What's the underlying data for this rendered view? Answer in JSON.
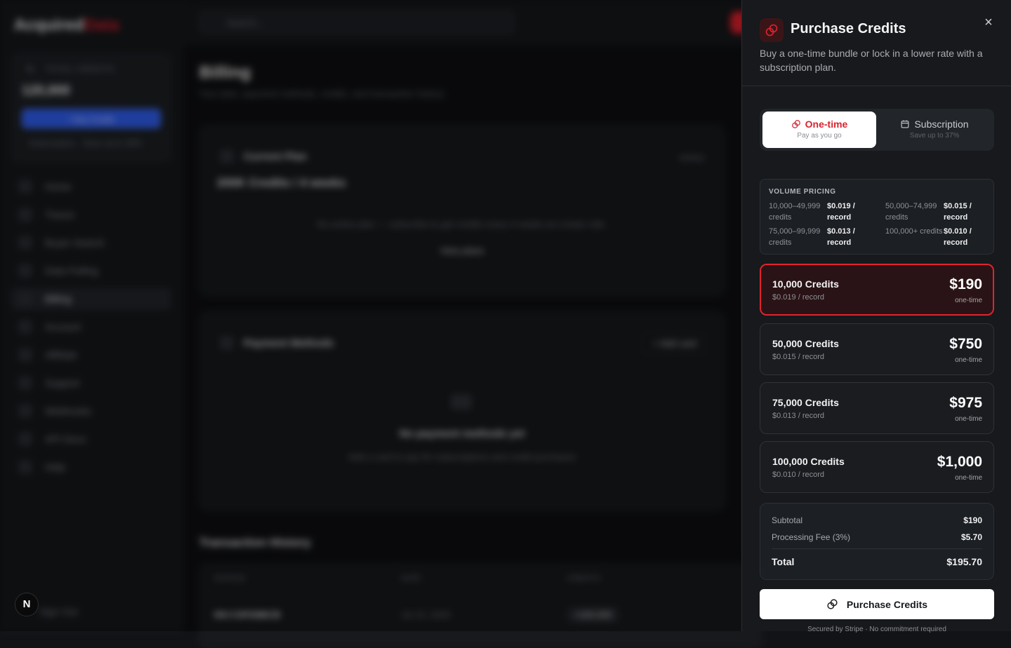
{
  "app": {
    "logo_main": "Acquired",
    "logo_accent": "Data"
  },
  "sidebar": {
    "credits_label": "TOTAL CREDITS",
    "credits_value": "120,000",
    "buy_button": "+ Buy Credits",
    "subscription_hint": "Subscription · Save up to 36%",
    "items": [
      {
        "label": "Home"
      },
      {
        "label": "Traces"
      },
      {
        "label": "Buyer Search"
      },
      {
        "label": "Data Pulling"
      },
      {
        "label": "Billing"
      },
      {
        "label": "Account"
      },
      {
        "label": "Affiliate"
      },
      {
        "label": "Support"
      },
      {
        "label": "Webhooks"
      },
      {
        "label": "API Docs"
      },
      {
        "label": "Help"
      }
    ],
    "sign_out": "Sign Out"
  },
  "topbar": {
    "search_placeholder": "Search..."
  },
  "billing": {
    "title": "Billing",
    "subtitle": "Your plan, payment methods, credits, and transaction history",
    "current_plan": {
      "title": "Current Plan",
      "badge": "Active",
      "plan_name": "200K Credits / 4 weeks",
      "empty_text": "No active plan — subscribe to get credits every 4 weeks at a lower rate.",
      "view_plans": "View plans"
    },
    "payment_methods": {
      "title": "Payment Methods",
      "add_card": "+ Add card",
      "empty_title": "No payment methods yet",
      "empty_text": "Add a card to pay for subscriptions and credit purchases"
    },
    "transactions": {
      "title": "Transaction History",
      "columns": [
        "INVOICE",
        "DATE",
        "CREDITS"
      ],
      "rows": [
        [
          "INV-C0FD8BCB",
          "Jul 15, 2025",
          "+100,000"
        ]
      ]
    }
  },
  "drawer": {
    "title": "Purchase Credits",
    "description": "Buy a one-time bundle or lock in a lower rate with a subscription plan.",
    "close_glyph": "×",
    "tabs": [
      {
        "label": "One-time",
        "sub": "Pay as you go",
        "active": true
      },
      {
        "label": "Subscription",
        "sub": "Save up to 37%",
        "active": false
      }
    ],
    "volume_pricing": {
      "title": "VOLUME PRICING",
      "tiers": [
        {
          "range": "10,000–49,999 credits",
          "price": "$0.019 / record"
        },
        {
          "range": "50,000–74,999 credits",
          "price": "$0.015 / record"
        },
        {
          "range": "75,000–99,999 credits",
          "price": "$0.013 / record"
        },
        {
          "range": "100,000+ credits",
          "price": "$0.010 / record"
        }
      ]
    },
    "packages": [
      {
        "name": "10,000 Credits",
        "rate": "$0.019 / record",
        "price": "$190",
        "type": "one-time",
        "selected": true
      },
      {
        "name": "50,000 Credits",
        "rate": "$0.015 / record",
        "price": "$750",
        "type": "one-time",
        "selected": false
      },
      {
        "name": "75,000 Credits",
        "rate": "$0.013 / record",
        "price": "$975",
        "type": "one-time",
        "selected": false
      },
      {
        "name": "100,000 Credits",
        "rate": "$0.010 / record",
        "price": "$1,000",
        "type": "one-time",
        "selected": false
      }
    ],
    "summary": {
      "subtotal_label": "Subtotal",
      "subtotal_value": "$190",
      "fee_label": "Processing Fee (3%)",
      "fee_value": "$5.70",
      "total_label": "Total",
      "total_value": "$195.70"
    },
    "purchase_button": "Purchase Credits",
    "secured_text": "Secured by Stripe · No commitment required"
  },
  "dev_badge": "N",
  "colors": {
    "accent_red": "#e0232f",
    "drawer_bg": "#17191c",
    "button_white": "#ffffff"
  }
}
